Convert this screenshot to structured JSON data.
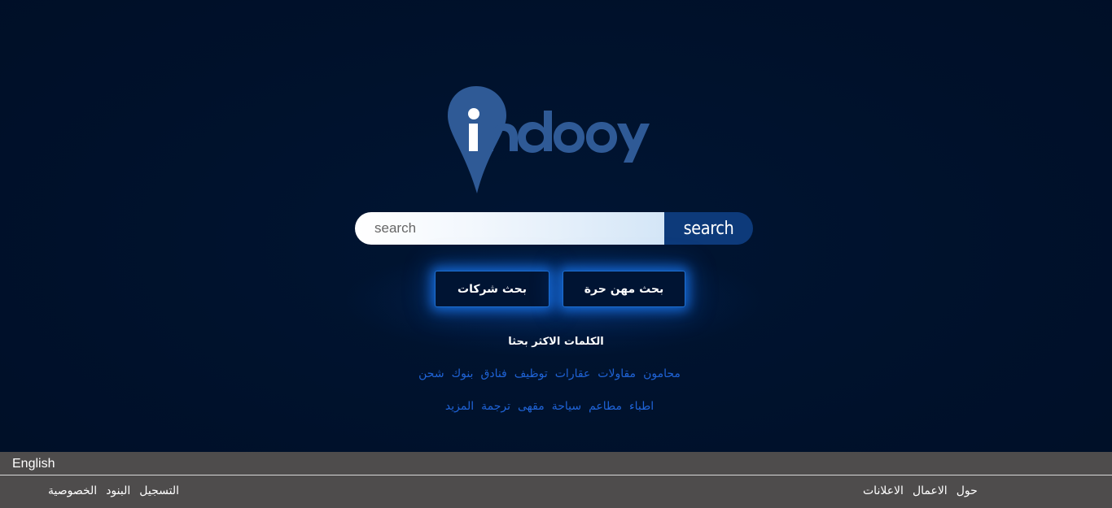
{
  "logo": {
    "text": "indooy",
    "brand_color": "#2f5a96",
    "pin_color": "#2f5a96"
  },
  "search": {
    "placeholder": "search",
    "value": "",
    "button_label": "search"
  },
  "category_buttons": {
    "companies_label": "بحث شركات",
    "professions_label": "بحث مهن حرة"
  },
  "popular": {
    "title": "الكلمات الاكثر بحثا",
    "row1": [
      "شحن",
      "بنوك",
      "فنادق",
      "توظيف",
      "عقارات",
      "مقاولات",
      "محامون"
    ],
    "row2": [
      "المزيد",
      "ترجمة",
      "مقهى",
      "سياحة",
      "مطاعم",
      "اطباء"
    ]
  },
  "footer": {
    "language": "English",
    "left_links": [
      "الخصوصية",
      "البنود",
      "التسجيل"
    ],
    "right_links": [
      "الاعلانات",
      "الاعمال",
      "حول"
    ]
  },
  "colors": {
    "background": "#00112b",
    "accent": "#1e6fd0",
    "keyword": "#1f63d6",
    "footer": "#4e4c4c"
  }
}
